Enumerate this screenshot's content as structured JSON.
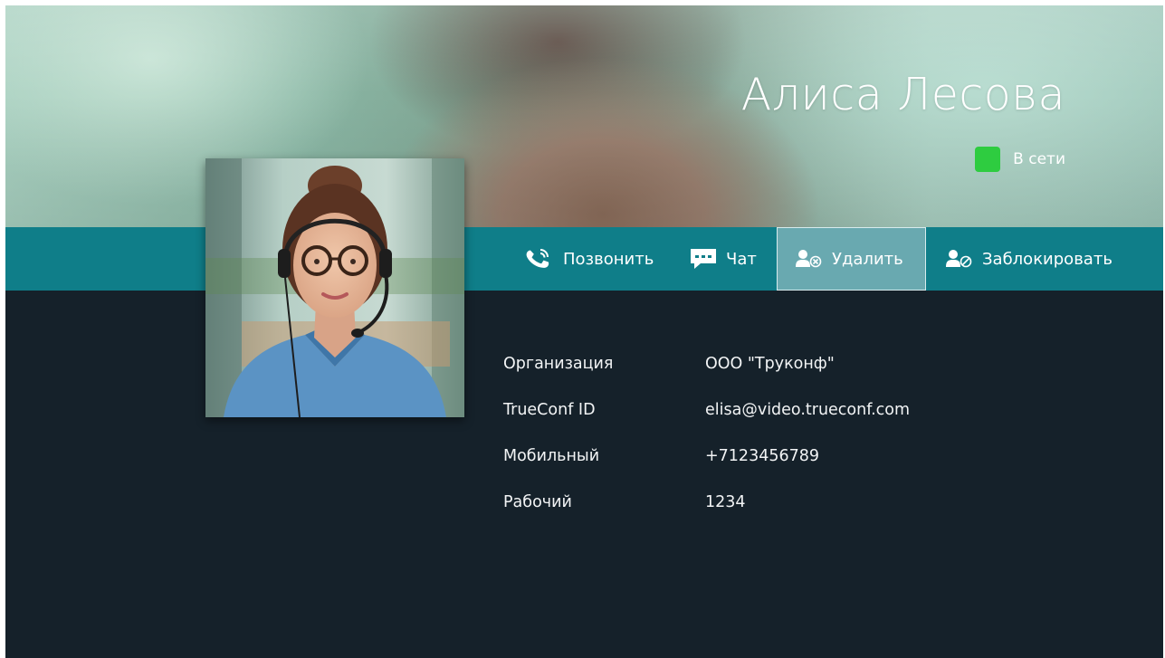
{
  "contact": {
    "name": "Алиса Лесова",
    "status": "В сети",
    "status_color": "#2ecc40"
  },
  "actions": [
    {
      "label": "Позвонить",
      "icon": "phone-icon",
      "active": false
    },
    {
      "label": "Чат",
      "icon": "chat-icon",
      "active": false
    },
    {
      "label": "Удалить",
      "icon": "remove-user-icon",
      "active": true
    },
    {
      "label": "Заблокировать",
      "icon": "block-user-icon",
      "active": false
    }
  ],
  "details": [
    {
      "label": "Организация",
      "value": "ООО \"Труконф\""
    },
    {
      "label": "TrueConf ID",
      "value": "elisa@video.trueconf.com"
    },
    {
      "label": "Мобильный",
      "value": "+7123456789"
    },
    {
      "label": "Рабочий",
      "value": "1234"
    }
  ],
  "colors": {
    "action_bar": "#0f7e89",
    "active_action": "#69a9b0",
    "background": "#15212a"
  }
}
